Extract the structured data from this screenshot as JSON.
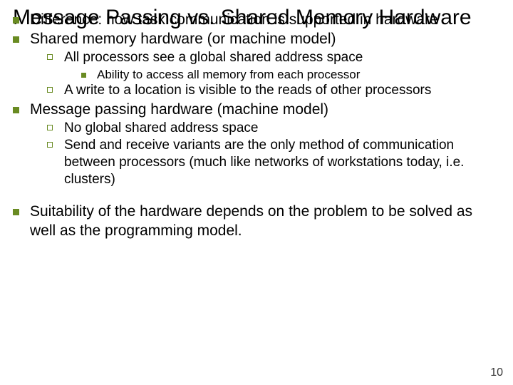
{
  "title": "Message Passing vs. Shared Memory Hardware",
  "bullets": {
    "b1": "Difference: how task communication is supported in hardware",
    "b2": "Shared memory hardware (or machine model)",
    "b2a": "All processors see a global shared address space",
    "b2a1": "Ability to access all memory from each processor",
    "b2b": "A write to a location is visible to the reads of other processors",
    "b3": "Message passing hardware (machine model)",
    "b3a": "No global shared address space",
    "b3b": "Send and receive variants are the only method of communication between processors (much like networks of workstations today, i.e. clusters)",
    "b4": "Suitability of the hardware depends on the problem to be solved as well as the programming model."
  },
  "page_number": "10"
}
